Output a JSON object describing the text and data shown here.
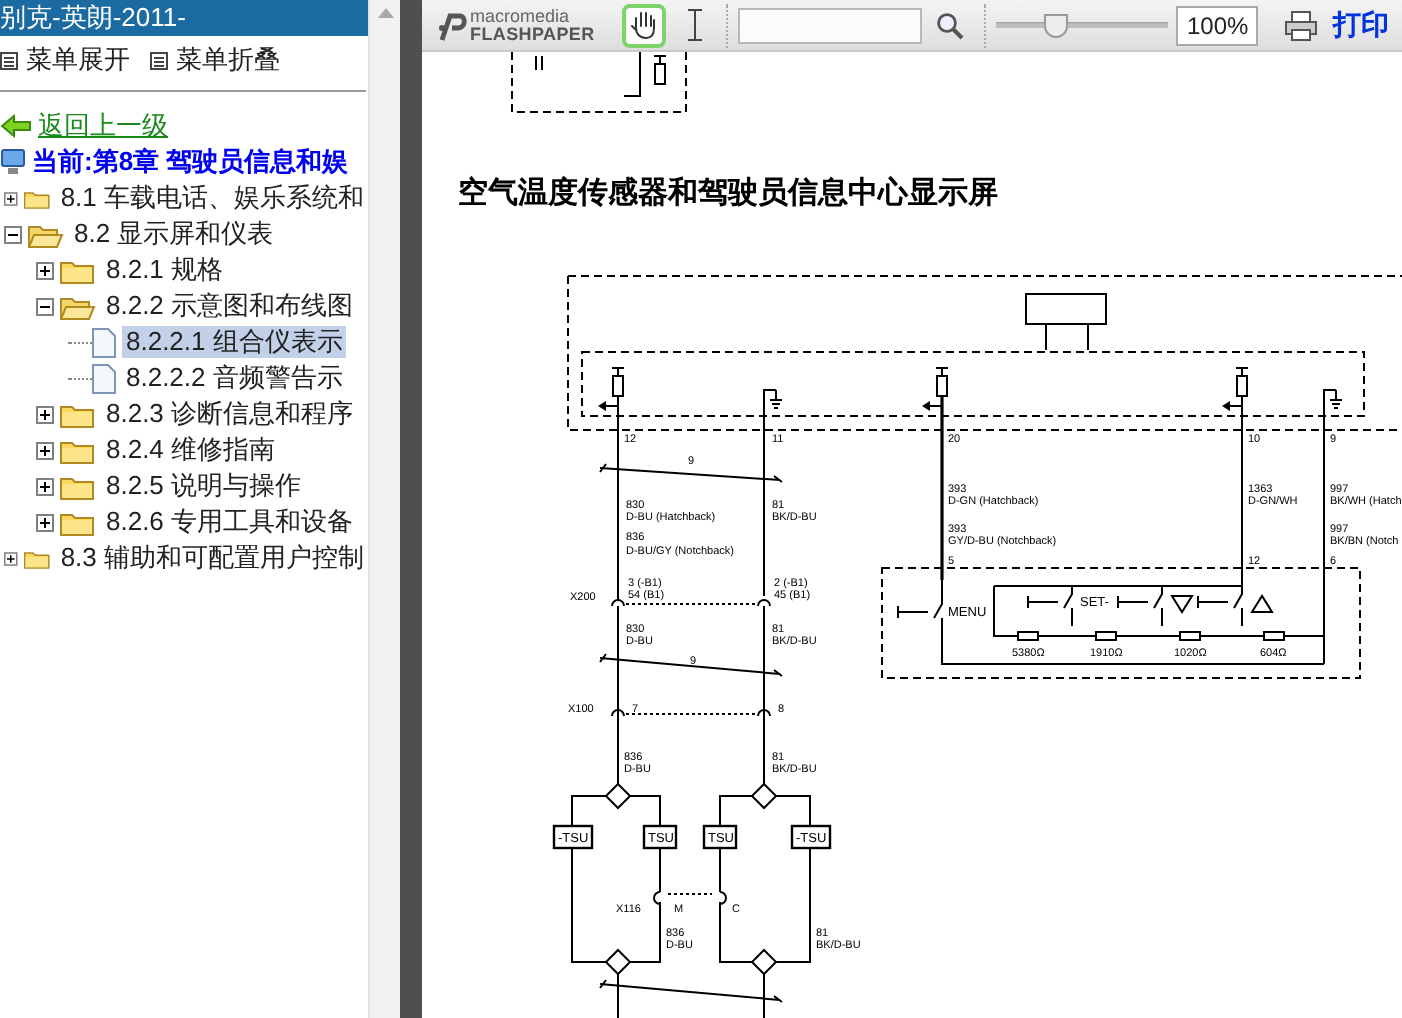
{
  "window": {
    "title": "别克-英朗-2011-"
  },
  "menu_buttons": [
    {
      "label": "菜单展开"
    },
    {
      "label": "菜单折叠"
    }
  ],
  "back_link": {
    "label": "返回上一级"
  },
  "current": {
    "label": "当前:第8章  驾驶员信息和娱"
  },
  "tree": [
    {
      "kind": "folder",
      "label": "8.1 车载电话、娱乐系统和",
      "expanded": false,
      "selected": false
    },
    {
      "kind": "folder",
      "label": "8.2 显示屏和仪表",
      "expanded": true,
      "selected": false,
      "children": [
        {
          "kind": "folder",
          "label": "8.2.1 规格",
          "expanded": false,
          "selected": false
        },
        {
          "kind": "folder",
          "label": "8.2.2 示意图和布线图",
          "expanded": true,
          "selected": false,
          "children": [
            {
              "kind": "page",
              "label": "8.2.2.1 组合仪表示",
              "selected": true
            },
            {
              "kind": "page",
              "label": "8.2.2.2 音频警告示",
              "selected": false
            }
          ]
        },
        {
          "kind": "folder",
          "label": "8.2.3 诊断信息和程序",
          "expanded": false,
          "selected": false
        },
        {
          "kind": "folder",
          "label": "8.2.4 维修指南",
          "expanded": false,
          "selected": false
        },
        {
          "kind": "folder",
          "label": "8.2.5 说明与操作",
          "expanded": false,
          "selected": false
        },
        {
          "kind": "folder",
          "label": "8.2.6 专用工具和设备",
          "expanded": false,
          "selected": false
        }
      ]
    },
    {
      "kind": "folder",
      "label": "8.3 辅助和可配置用户控制",
      "expanded": false,
      "selected": false
    }
  ],
  "toolbar": {
    "logo_top": "macromedia",
    "logo_bottom": "FLASHPAPER",
    "hand_tool": {
      "selected": true
    },
    "zoom": {
      "level": 0.35
    },
    "zoom_value": "100%",
    "print": "打印"
  },
  "document": {
    "heading": "空气温度传感器和驾驶员信息中心显示屏",
    "diagram_labels": [
      "12",
      "11",
      "20",
      "10",
      "9",
      "9",
      "830",
      "D-BU (Hatchback)",
      "836",
      "D-BU/GY (Notchback)",
      "81",
      "BK/D-BU",
      "393",
      "D-GN (Hatchback)",
      "393",
      "GY/D-BU (Notchback)",
      "1363",
      "D-GN/WH",
      "997",
      "BK/WH (Hatch",
      "997",
      "BK/BN (Notch",
      "5",
      "12",
      "6",
      "X200",
      "3 (-B1)",
      "54 (B1)",
      "2 (-B1)",
      "45 (B1)",
      "MENU",
      "SET-",
      "5380Ω",
      "1910Ω",
      "1020Ω",
      "604Ω",
      "830",
      "D-BU",
      "81",
      "BK/D-BU",
      "9",
      "X100",
      "7",
      "8",
      "836",
      "D-BU",
      "81",
      "BK/D-BU",
      "-TSU",
      "TSU",
      "TSU",
      "-TSU",
      "X116",
      "M",
      "C",
      "836",
      "D-BU",
      "81",
      "BK/D-BU"
    ]
  }
}
